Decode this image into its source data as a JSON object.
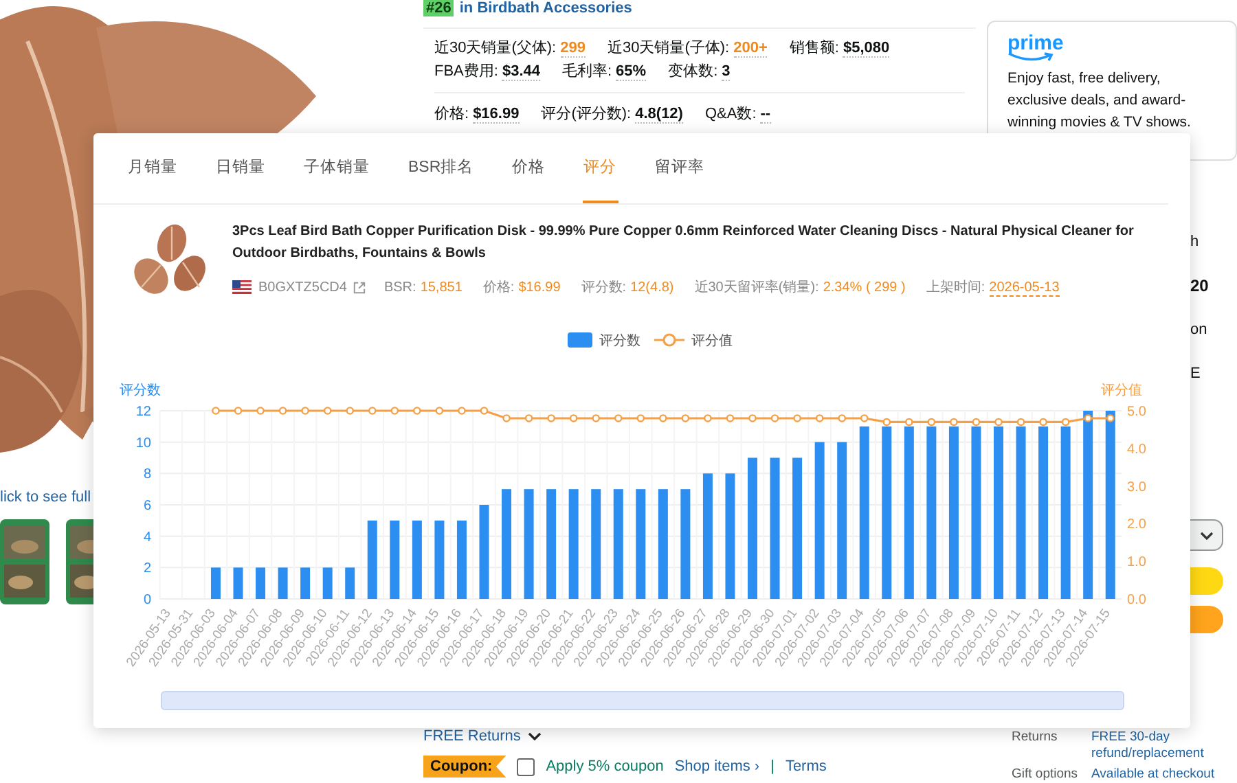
{
  "left_panel": {
    "image_link": "lick to see full"
  },
  "rank": {
    "badge": "#26",
    "text": "in Birdbath Accessories"
  },
  "stats": [
    [
      {
        "label": "近30天销量(父体):",
        "value": "299",
        "highlight": true
      },
      {
        "label": "近30天销量(子体):",
        "value": "200+",
        "highlight": true
      },
      {
        "label": "销售额:",
        "value": "$5,080",
        "highlight": false
      }
    ],
    [
      {
        "label": "FBA费用:",
        "value": "$3.44",
        "highlight": false
      },
      {
        "label": "毛利率:",
        "value": "65%",
        "highlight": false
      },
      {
        "label": "变体数:",
        "value": "3",
        "highlight": false
      }
    ],
    [
      {
        "label": "价格:",
        "value": "$16.99",
        "highlight": false
      },
      {
        "label": "评分(评分数):",
        "value": "4.8(12)",
        "highlight": false
      },
      {
        "label": "Q&A数:",
        "value": "--",
        "highlight": false
      }
    ]
  ],
  "returns_link": "FREE Returns",
  "coupon": {
    "badge": "Coupon:",
    "checked": false,
    "text": "Apply 5% coupon",
    "shop_link": "Shop items ›",
    "separator": "|",
    "terms_link": "Terms"
  },
  "prime_box": {
    "logo": "prime",
    "text": "Enjoy fast, free delivery, exclusive deals, and award-winning movies & TV shows."
  },
  "right_fragments": [
    {
      "text": "h",
      "bold": false
    },
    {
      "text": "20",
      "bold": true
    },
    {
      "text": "on",
      "bold": false
    },
    {
      "text": "E",
      "bold": false
    }
  ],
  "details": [
    {
      "label": "Returns",
      "value": "FREE 30-day refund/replacement"
    },
    {
      "label": "Gift options",
      "value": "Available at checkout"
    }
  ],
  "popup": {
    "tabs": [
      {
        "label": "月销量",
        "selected": false
      },
      {
        "label": "日销量",
        "selected": false
      },
      {
        "label": "子体销量",
        "selected": false
      },
      {
        "label": "BSR排名",
        "selected": false
      },
      {
        "label": "价格",
        "selected": false
      },
      {
        "label": "评分",
        "selected": true
      },
      {
        "label": "留评率",
        "selected": false
      }
    ],
    "product": {
      "title": "3Pcs Leaf Bird Bath Copper Purification Disk - 99.99% Pure Copper 0.6mm Reinforced Water Cleaning Discs - Natural Physical Cleaner for Outdoor Birdbaths, Fountains & Bowls",
      "asin": "B0GXTZ5CD4",
      "meta": [
        {
          "label": "BSR:",
          "value": "15,851"
        },
        {
          "label": "价格:",
          "value": "$16.99"
        },
        {
          "label": "评分数:",
          "value": "12(4.8)"
        },
        {
          "label": "近30天留评率(销量):",
          "value": "2.34% ( 299 )"
        },
        {
          "label": "上架时间:",
          "value": "2026-05-13"
        }
      ]
    },
    "range_slider": {
      "level": 1
    },
    "chart_data": {
      "type": "bar",
      "grid": true,
      "legend": "top",
      "ylabel": "评分数",
      "ylim": [
        0,
        12
      ],
      "yticks": [
        0,
        2,
        4,
        6,
        8,
        10,
        12
      ],
      "y2label": "评分值",
      "y2lim": [
        0,
        5
      ],
      "y2ticks": [
        {
          "value": 0,
          "label": "0.0"
        },
        {
          "value": 1,
          "label": "1.0"
        },
        {
          "value": 2,
          "label": "2.0"
        },
        {
          "value": 3,
          "label": "3.0"
        },
        {
          "value": 4,
          "label": "4.0"
        },
        {
          "value": 5,
          "label": "5.0"
        }
      ],
      "categories": [
        "2026-05-13",
        "2026-05-31",
        "2026-06-03",
        "2026-06-04",
        "2026-06-07",
        "2026-06-08",
        "2026-06-09",
        "2026-06-10",
        "2026-06-11",
        "2026-06-12",
        "2026-06-13",
        "2026-06-14",
        "2026-06-15",
        "2026-06-16",
        "2026-06-17",
        "2026-06-18",
        "2026-06-19",
        "2026-06-20",
        "2026-06-21",
        "2026-06-22",
        "2026-06-23",
        "2026-06-24",
        "2026-06-25",
        "2026-06-26",
        "2026-06-27",
        "2026-06-28",
        "2026-06-29",
        "2026-06-30",
        "2026-07-01",
        "2026-07-02",
        "2026-07-03",
        "2026-07-04",
        "2026-07-05",
        "2026-07-06",
        "2026-07-07",
        "2026-07-08",
        "2026-07-09",
        "2026-07-10",
        "2026-07-11",
        "2026-07-12",
        "2026-07-13",
        "2026-07-14",
        "2026-07-15"
      ],
      "series": [
        {
          "name": "评分数",
          "color": "#2b8ef0",
          "values": [
            null,
            null,
            2,
            2,
            2,
            2,
            2,
            2,
            2,
            5,
            5,
            5,
            5,
            5,
            6,
            7,
            7,
            7,
            7,
            7,
            7,
            7,
            7,
            7,
            8,
            8,
            9,
            9,
            9,
            10,
            10,
            11,
            11,
            11,
            11,
            11,
            11,
            11,
            11,
            11,
            11,
            12,
            12
          ]
        },
        {
          "name": "评分值",
          "type": "line",
          "axis": "y2",
          "marker": "circle",
          "color": "#f5a047",
          "values": [
            null,
            null,
            5.0,
            5.0,
            5.0,
            5.0,
            5.0,
            5.0,
            5.0,
            5.0,
            5.0,
            5.0,
            5.0,
            5.0,
            5.0,
            4.8,
            4.8,
            4.8,
            4.8,
            4.8,
            4.8,
            4.8,
            4.8,
            4.8,
            4.8,
            4.8,
            4.8,
            4.8,
            4.8,
            4.8,
            4.8,
            4.8,
            4.7,
            4.7,
            4.7,
            4.7,
            4.7,
            4.7,
            4.7,
            4.7,
            4.7,
            4.8,
            4.8
          ]
        }
      ]
    }
  }
}
